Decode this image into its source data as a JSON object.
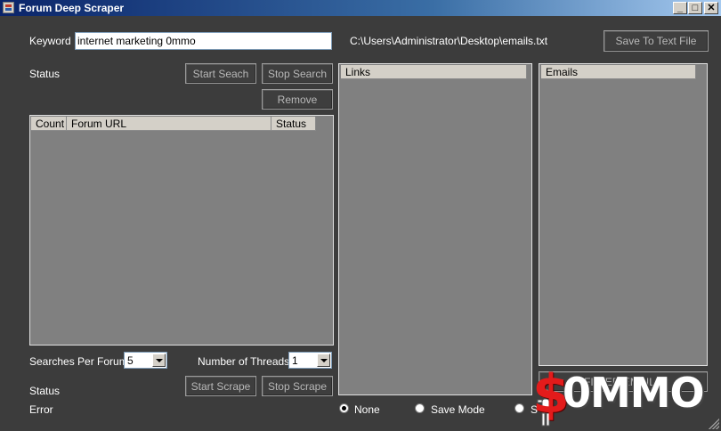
{
  "window": {
    "title": "Forum Deep Scraper",
    "controls": {
      "minimize": "_",
      "maximize": "□",
      "close": "✕"
    }
  },
  "search": {
    "keyword_label": "Keyword",
    "keyword_value": "internet marketing 0mmo",
    "status_label": "Status",
    "start_search": "Start Seach",
    "stop_search": "Stop Search",
    "remove": "Remove",
    "file_path": "C:\\Users\\Administrator\\Desktop\\emails.txt",
    "save_to_text_file": "Save To Text File"
  },
  "forum_table": {
    "columns": [
      "Count",
      "Forum URL",
      "Status"
    ],
    "rows": []
  },
  "links_panel": {
    "header": "Links"
  },
  "emails_panel": {
    "header": "Emails",
    "filter_button": "FILTER EMAILS"
  },
  "scrape": {
    "searches_per_forum_label": "Searches Per Forum",
    "searches_per_forum_value": "5",
    "threads_label": "Number of Threads",
    "threads_value": "1",
    "status_label": "Status",
    "error_label": "Error",
    "start_scrape": "Start Scrape",
    "stop_scrape": "Stop Scrape"
  },
  "modes": {
    "options": [
      "None",
      "Save Mode",
      "S"
    ],
    "selected": "None"
  },
  "watermark": {
    "text": "0MMO",
    "symbol": "$"
  }
}
